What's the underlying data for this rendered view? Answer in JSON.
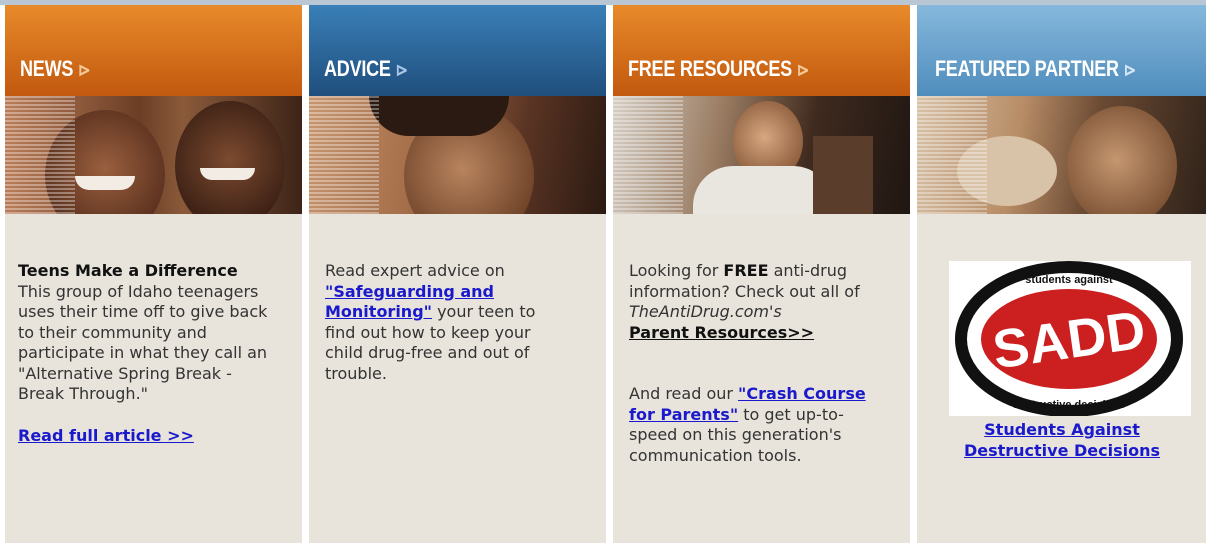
{
  "columns": [
    {
      "header": "NEWS",
      "headline": "Teens Make a Difference",
      "body": "This group of Idaho teenagers uses their time off to give back to their community and participate in what they call an \"Alternative Spring Break - Break Through.\"",
      "link": "Read full article >>"
    },
    {
      "header": "ADVICE",
      "text_before": "Read expert advice on ",
      "link": "\"Safeguarding and Monitoring\"",
      "text_after": " your teen to find out how to keep your child drug-free and out of trouble."
    },
    {
      "header": "FREE RESOURCES",
      "p1_a": "Looking for ",
      "p1_bold": "FREE",
      "p1_b": " anti-drug information? Check out all of ",
      "p1_italic": "TheAntiDrug.com's",
      "p1_link": "Parent Resources>>",
      "p2_a": "And read our ",
      "p2_link": "\"Crash Course for Parents\"",
      "p2_b": " to get up-to-speed on this generation's communication tools."
    },
    {
      "header": "FEATURED PARTNER",
      "logo_top": "students against",
      "logo_mid": "SADD",
      "logo_bottom": "destructive decisions",
      "link": "Students Against Destructive Decisions"
    }
  ],
  "arrow_glyph": "⊳",
  "colors": {
    "orange_top": "#e07a1c",
    "orange_bottom": "#b5500e",
    "blue_top": "#2f74ad",
    "blue_bottom": "#1e4f7c",
    "lightblue_top": "#7fb3d8",
    "lightblue_bottom": "#4d8cbd",
    "body_bg": "#e8e4dc",
    "link": "#1a1acc"
  }
}
